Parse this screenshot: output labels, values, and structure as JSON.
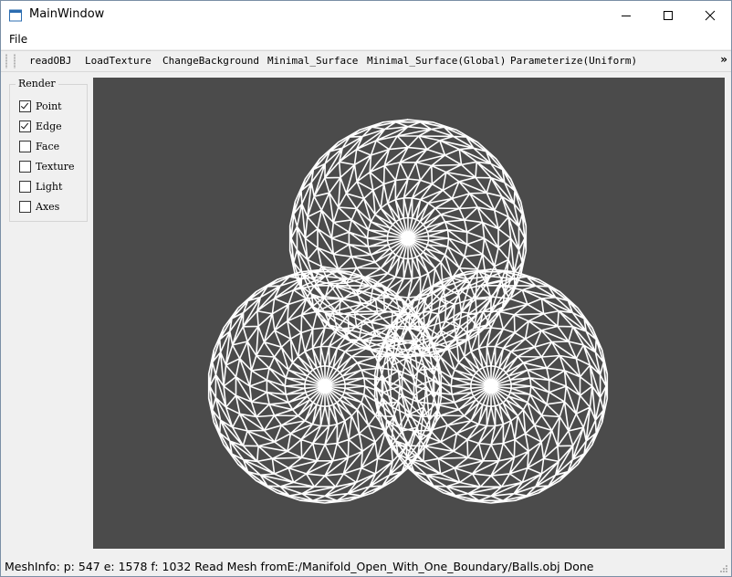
{
  "window": {
    "title": "MainWindow"
  },
  "menubar": {
    "items": [
      "File"
    ]
  },
  "toolbar": {
    "buttons": [
      "readOBJ",
      "LoadTexture",
      "ChangeBackground",
      "Minimal_Surface",
      "Minimal_Surface(Global)",
      "Parameterize(Uniform)"
    ],
    "overflow": "»"
  },
  "render_panel": {
    "title": "Render",
    "options": [
      {
        "label": "Point",
        "checked": true
      },
      {
        "label": "Edge",
        "checked": true
      },
      {
        "label": "Face",
        "checked": false
      },
      {
        "label": "Texture",
        "checked": false
      },
      {
        "label": "Light",
        "checked": false
      },
      {
        "label": "Axes",
        "checked": false
      }
    ]
  },
  "viewport": {
    "background": "#4b4b4b",
    "mesh_color": "#ffffff"
  },
  "statusbar": {
    "text": "MeshInfo: p: 547 e: 1578 f: 1032  Read Mesh fromE:/Manifold_Open_With_One_Boundary/Balls.obj Done"
  }
}
